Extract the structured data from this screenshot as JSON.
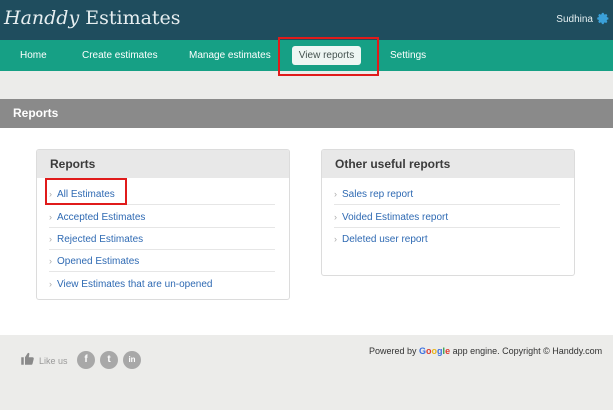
{
  "app": {
    "logo_script": "Handdy",
    "logo_rest": " Estimates"
  },
  "header": {
    "user_name": "Sudhina",
    "settings_icon": "gear-icon"
  },
  "nav": {
    "home": "Home",
    "create": "Create estimates",
    "manage": "Manage estimates",
    "view_reports": "View reports",
    "settings": "Settings"
  },
  "page": {
    "title": "Reports"
  },
  "reports_card": {
    "title": "Reports",
    "items": [
      "All Estimates",
      "Accepted Estimates",
      "Rejected Estimates",
      "Opened Estimates",
      "View Estimates that are un-opened"
    ]
  },
  "other_card": {
    "title": "Other useful reports",
    "items": [
      "Sales rep report",
      "Voided Estimates report",
      "Deleted user report"
    ]
  },
  "footer": {
    "like_us": "Like us",
    "social": [
      "f",
      "t",
      "in"
    ],
    "powered_by": "Powered by ",
    "google": [
      "G",
      "o",
      "o",
      "g",
      "l",
      "e"
    ],
    "powered_rest": " app engine. Copyright © Handdy.com"
  },
  "colors": {
    "topbar": "#1f4d5e",
    "navbar": "#16a085",
    "link": "#2f6ab3",
    "highlight": "#e01b1b"
  }
}
